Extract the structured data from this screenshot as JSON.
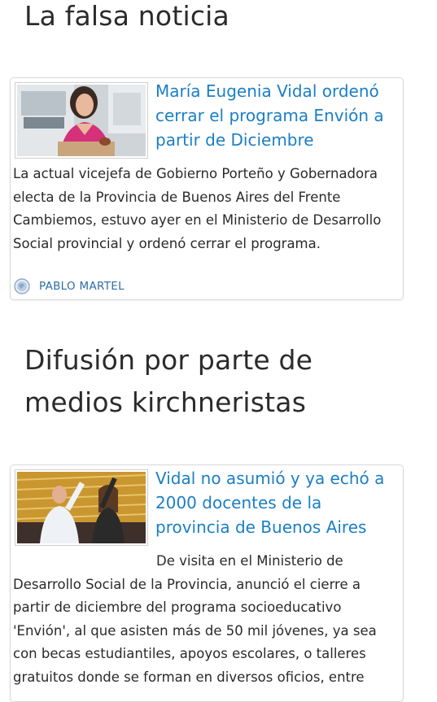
{
  "section1": {
    "title": "La falsa noticia",
    "card": {
      "headline": "María Eugenia Vidal ordenó cerrar el programa Envión a partir de Diciembre",
      "excerpt": "La actual vicejefa de Gobierno Porteño y Gobernadora electa de la Provincia de Buenos Aires del Frente Cambiemos, estuvo ayer en el Ministerio de Desarrollo Social provincial y ordenó cerrar el programa.",
      "source": "PABLO MARTEL",
      "source_icon": "globe-icon"
    }
  },
  "section2": {
    "title": "Difusión por parte de medios kirchneristas",
    "card": {
      "headline": "Vidal no asumió y ya echó a 2000 docentes de la provincia de Buenos Aires",
      "excerpt": "De visita en el Ministerio de Desarrollo Social de la Provincia, anunció el cierre a partir de diciembre del programa socioeducativo 'Envión', al que asisten más de 50 mil jóvenes, ya sea con becas estudiantiles, apoyos escolares, o talleres gratuitos donde se forman en diversos oficios, entre"
    }
  },
  "colors": {
    "headline": "#1a7fc4",
    "source": "#2f6da3",
    "title": "#2b2b2b"
  }
}
